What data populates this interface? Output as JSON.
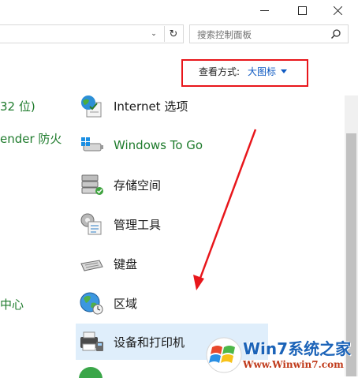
{
  "window": {
    "controls": {
      "minimize_icon": "minimize-icon",
      "maximize_icon": "maximize-icon",
      "close_icon": "close-icon"
    }
  },
  "address_bar": {
    "dropdown_icon": "chevron-down-icon",
    "refresh_icon": "refresh-icon"
  },
  "search": {
    "placeholder": "搜索控制面板",
    "icon": "search-icon"
  },
  "view_by": {
    "label": "查看方式:",
    "value": "大图标"
  },
  "left_column": [
    {
      "text": "32 位)"
    },
    {
      "text": "ender 防火"
    },
    {
      "text": "中心"
    }
  ],
  "items": [
    {
      "label": "Internet 选项",
      "icon": "internet-options-icon"
    },
    {
      "label": "Windows To Go",
      "icon": "windows-to-go-icon"
    },
    {
      "label": "存储空间",
      "icon": "storage-spaces-icon"
    },
    {
      "label": "管理工具",
      "icon": "admin-tools-icon"
    },
    {
      "label": "键盘",
      "icon": "keyboard-icon"
    },
    {
      "label": "区域",
      "icon": "region-icon"
    },
    {
      "label": "设备和打印机",
      "icon": "devices-printers-icon",
      "selected": true
    }
  ],
  "colors": {
    "link_blue": "#0f5ac2",
    "highlight_red": "#e8161b",
    "item_green": "#1e7b2c",
    "selection_bg": "#dfeefb"
  },
  "watermark": {
    "title": "Win7系统之家",
    "url": "Www.Winwin7.com"
  }
}
